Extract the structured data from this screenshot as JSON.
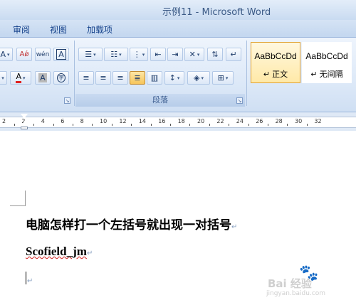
{
  "window": {
    "title": "示例11 - Microsoft Word"
  },
  "tabs": [
    {
      "label": "审阅"
    },
    {
      "label": "视图"
    },
    {
      "label": "加载项"
    }
  ],
  "ribbon": {
    "font_group": {
      "aa_label": "A",
      "phonetic_label": "变",
      "wen_label": "wén",
      "border_label": "A",
      "font_color_label": "A",
      "char_shade_label": "A",
      "enclose_label": "字"
    },
    "paragraph_group": {
      "label": "段落"
    },
    "styles": [
      {
        "sample": "AaBbCcDd",
        "name": "正文",
        "selected": true
      },
      {
        "sample": "AaBbCcDd",
        "name": "无间隔",
        "selected": false
      }
    ]
  },
  "ruler": {
    "numbers": [
      "2",
      "2",
      "4",
      "6",
      "8",
      "10",
      "12",
      "14",
      "16",
      "18",
      "20",
      "22",
      "24",
      "26",
      "28",
      "30",
      "32"
    ]
  },
  "document": {
    "lines": [
      {
        "text": "电脑怎样打一个左括号就出现一对括号"
      },
      {
        "text": "Scofield_jm"
      }
    ],
    "paragraph_mark": "↵"
  },
  "watermark": {
    "text": "Bai 经验",
    "sub": "jingyan.baidu.com"
  },
  "colors": {
    "accent": "#15428b",
    "ribbon": "#dde9f8",
    "active": "#f7c55b"
  }
}
